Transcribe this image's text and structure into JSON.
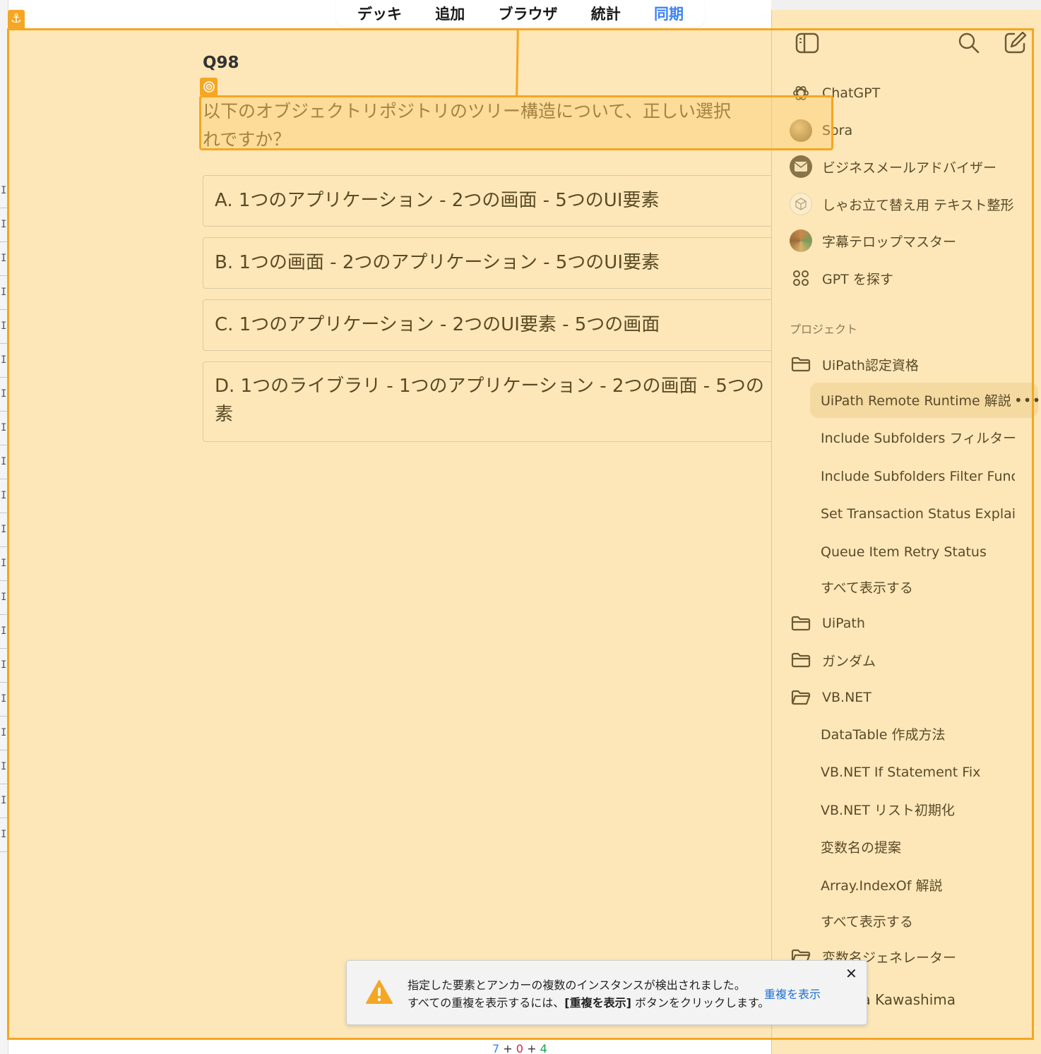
{
  "anki": {
    "nav": {
      "deck": "デッキ",
      "add": "追加",
      "browse": "ブラウザ",
      "stats": "統計",
      "sync": "同期"
    },
    "card": {
      "title": "Q98",
      "question_line1": "以下のオブジェクトリポジトリのツリー構造について、正しい選択",
      "question_line2": "れですか？",
      "choices": {
        "a": "A. 1つのアプリケーション - 2つの画面 - 5つのUI要素",
        "b": "B. 1つの画面 - 2つのアプリケーション - 5つのUI要素",
        "c": "C. 1つのアプリケーション - 2つのUI要素 - 5つの画面",
        "d_line1": "D. 1つのライブラリ - 1つのアプリケーション - 2つの画面 - 5つの",
        "d_line2": "素"
      }
    },
    "counter": {
      "new": "7",
      "learn": "0",
      "review": "4",
      "plus": "+"
    }
  },
  "chatgpt": {
    "gpts": [
      "ChatGPT",
      "Sora",
      "ビジネスメールアドバイザー",
      "しゃお立て替え用 テキスト整形",
      "字幕テロップマスター",
      "GPT を探す"
    ],
    "projects_label": "プロジェクト",
    "projects": {
      "uipath_cert": "UiPath認定資格",
      "uipath_cert_chats": [
        "UiPath Remote Runtime 解説",
        "Include Subfolders フィルター解説",
        "Include Subfolders Filter Function",
        "Set Transaction Status Explained",
        "Queue Item Retry Status",
        "すべて表示する"
      ],
      "uipath": "UiPath",
      "gundam": "ガンダム",
      "vbnet": "VB.NET",
      "vbnet_chats": [
        "DataTable 作成方法",
        "VB.NET If Statement Fix",
        "VB.NET リスト初期化",
        "変数名の提案",
        "Array.IndexOf 解説",
        "すべて表示する"
      ],
      "var_gen": "変数名ジェネレーター"
    },
    "more_icon": "•••",
    "user": "Seiya Kawashima"
  },
  "uipath_toast": {
    "line1": "指定した要素とアンカーの複数のインスタンスが検出されました。",
    "line2_pre": "すべての重複を表示するには、",
    "line2_bold": "[重複を表示]",
    "line2_post": " ボタンをクリックします。",
    "show_duplicates": "重複を表示",
    "close": "✕"
  },
  "left_glyph": "I",
  "colors": {
    "highlight": "#f5a623",
    "card_bg": "#fde7b8",
    "sync_blue": "#3b82f6",
    "link_blue": "#1f6fd1"
  }
}
